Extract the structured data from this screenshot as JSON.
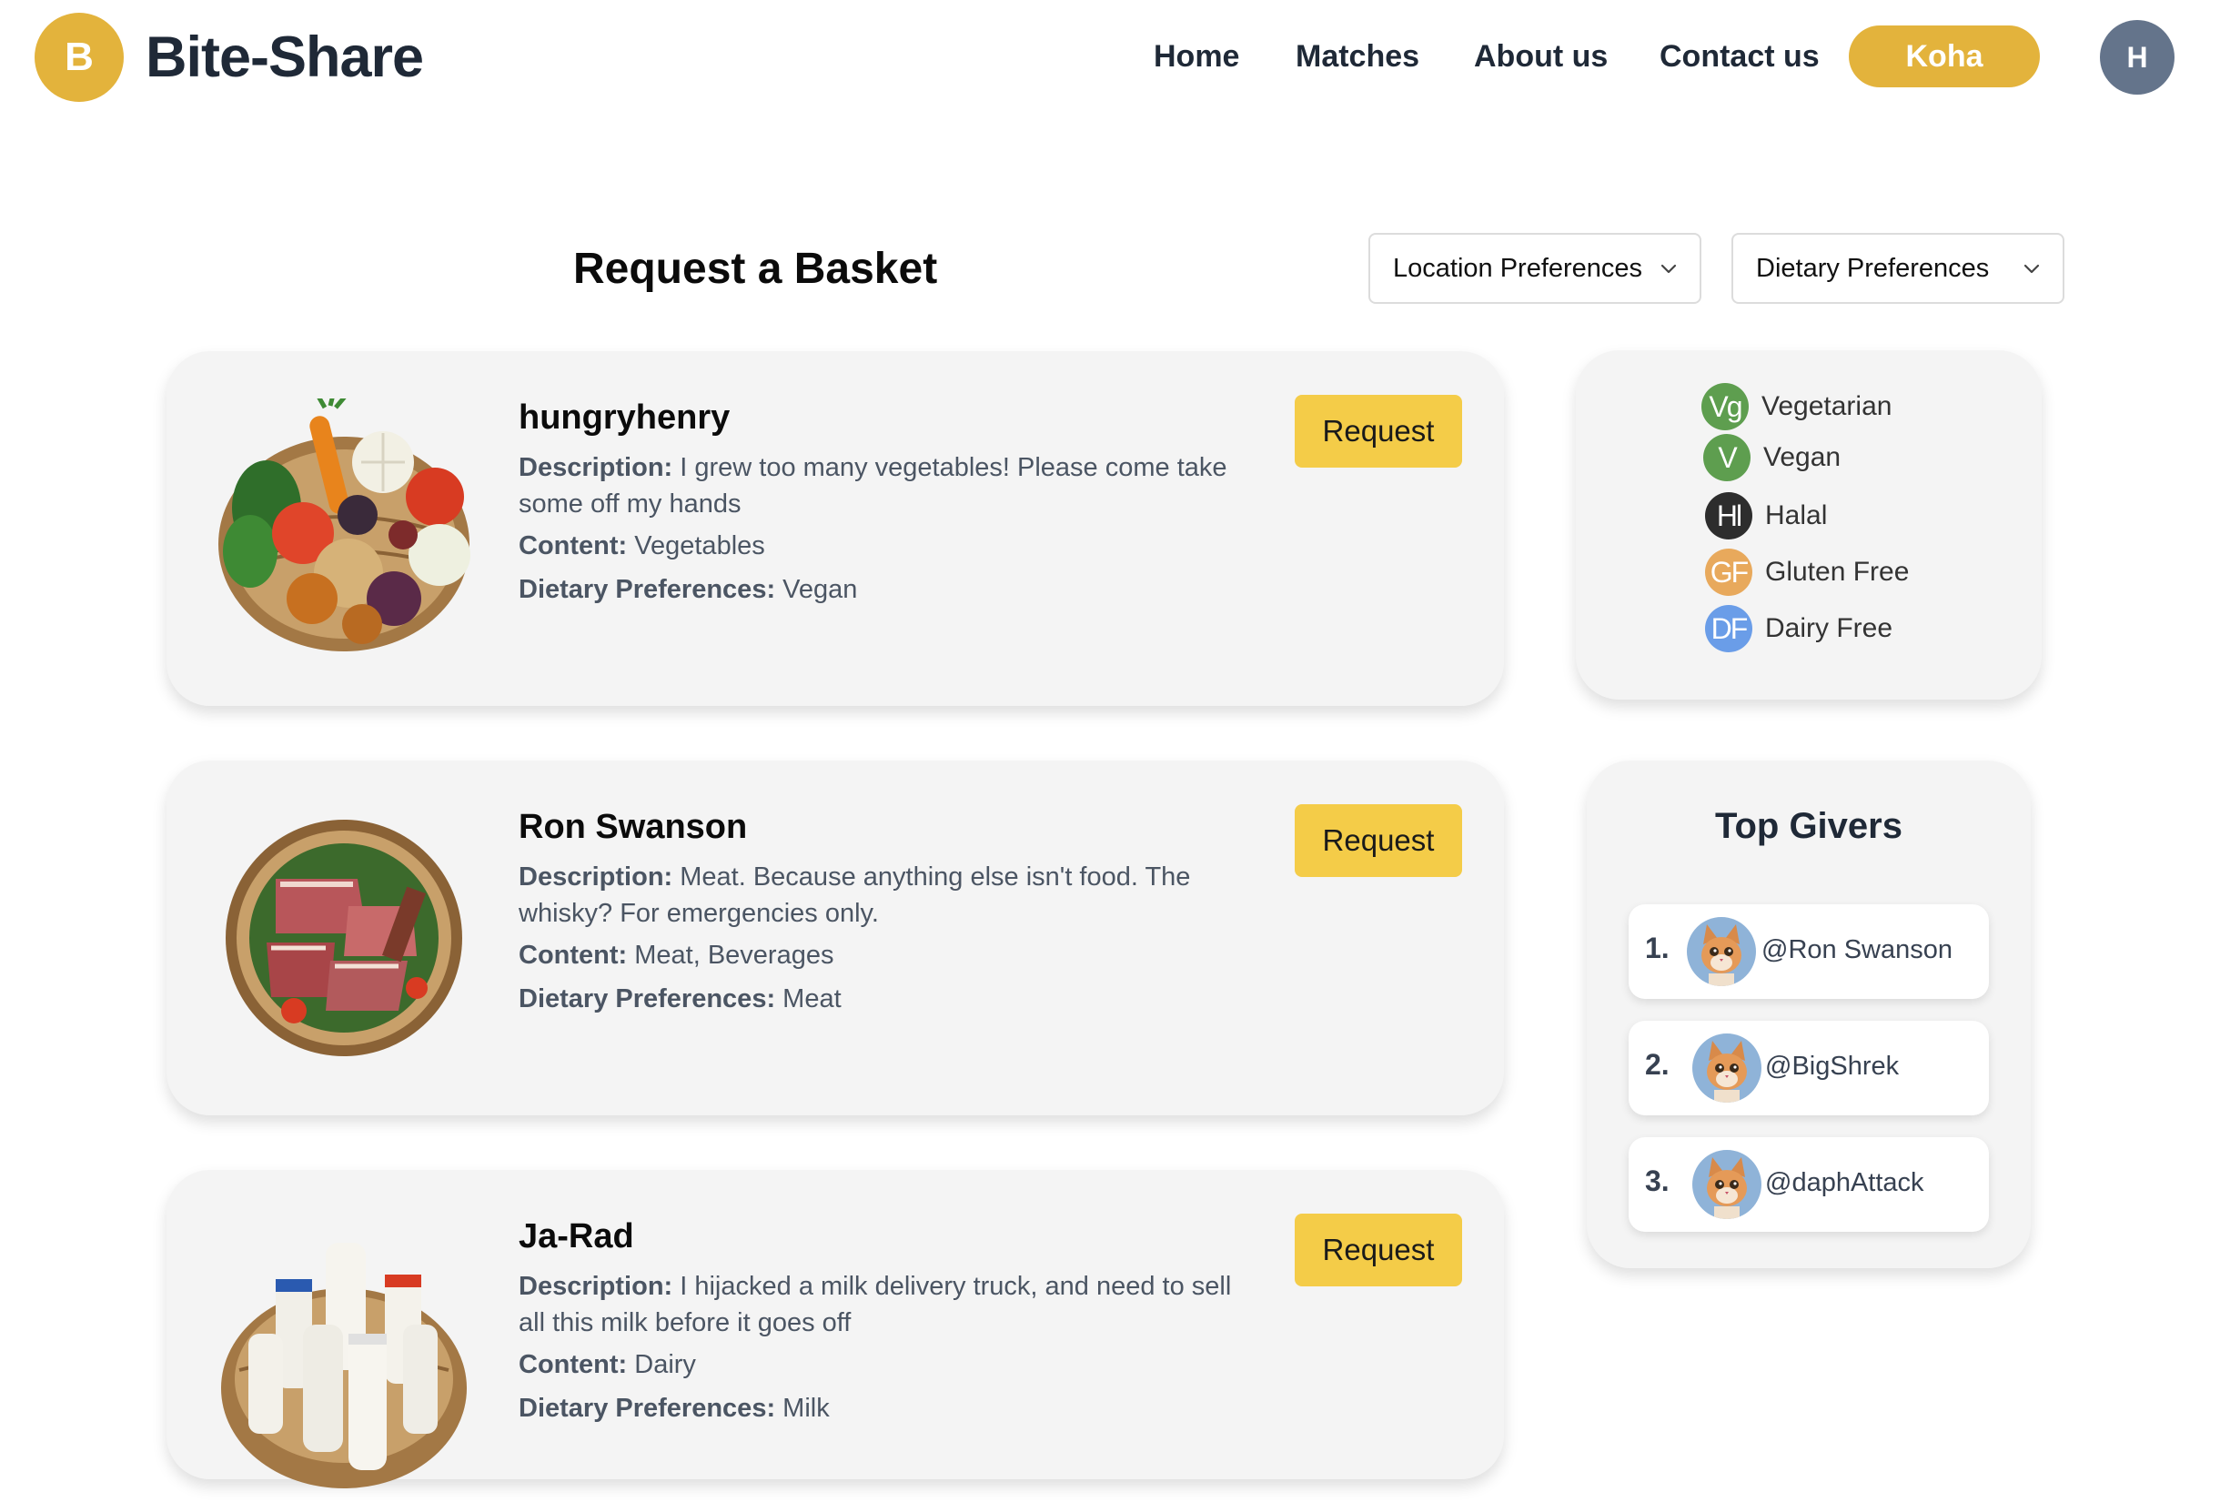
{
  "header": {
    "logo_letter": "B",
    "brand": "Bite-Share",
    "nav": [
      "Home",
      "Matches",
      "About us",
      "Contact us"
    ],
    "cta": "Koha",
    "avatar_initial": "H",
    "accent_color": "#E3B33C"
  },
  "page": {
    "title": "Request a Basket",
    "filters": {
      "location": "Location Preferences",
      "dietary": "Dietary Preferences"
    }
  },
  "labels": {
    "description": "Description:",
    "content": "Content:",
    "dietary": "Dietary Preferences:",
    "request": "Request"
  },
  "baskets": [
    {
      "name": "hungryhenry",
      "description": "I grew too many vegetables! Please come take some off my hands",
      "content": "Vegetables",
      "dietary": "Vegan",
      "image": "vegetable-basket"
    },
    {
      "name": "Ron Swanson",
      "description": "Meat. Because anything else isn't food. The whisky? For emergencies only.",
      "content": "Meat, Beverages",
      "dietary": "Meat",
      "image": "meat-basket"
    },
    {
      "name": "Ja-Rad",
      "description": "I hijacked a milk delivery truck, and need to sell all this milk before it goes off",
      "content": "Dairy",
      "dietary": "Milk",
      "image": "milk-basket"
    }
  ],
  "legend": [
    {
      "code": "Vg",
      "label": "Vegetarian",
      "color": "#5E9E4F"
    },
    {
      "code": "V",
      "label": "Vegan",
      "color": "#5E9E4F"
    },
    {
      "code": "Hl",
      "label": "Halal",
      "color": "#2d2d2d"
    },
    {
      "code": "GF",
      "label": "Gluten Free",
      "color": "#E8A95C"
    },
    {
      "code": "DF",
      "label": "Dairy Free",
      "color": "#6A9DE8"
    }
  ],
  "top_givers": {
    "title": "Top Givers",
    "list": [
      {
        "rank": "1.",
        "handle": "@Ron Swanson"
      },
      {
        "rank": "2.",
        "handle": "@BigShrek"
      },
      {
        "rank": "3.",
        "handle": "@daphAttack"
      }
    ]
  }
}
